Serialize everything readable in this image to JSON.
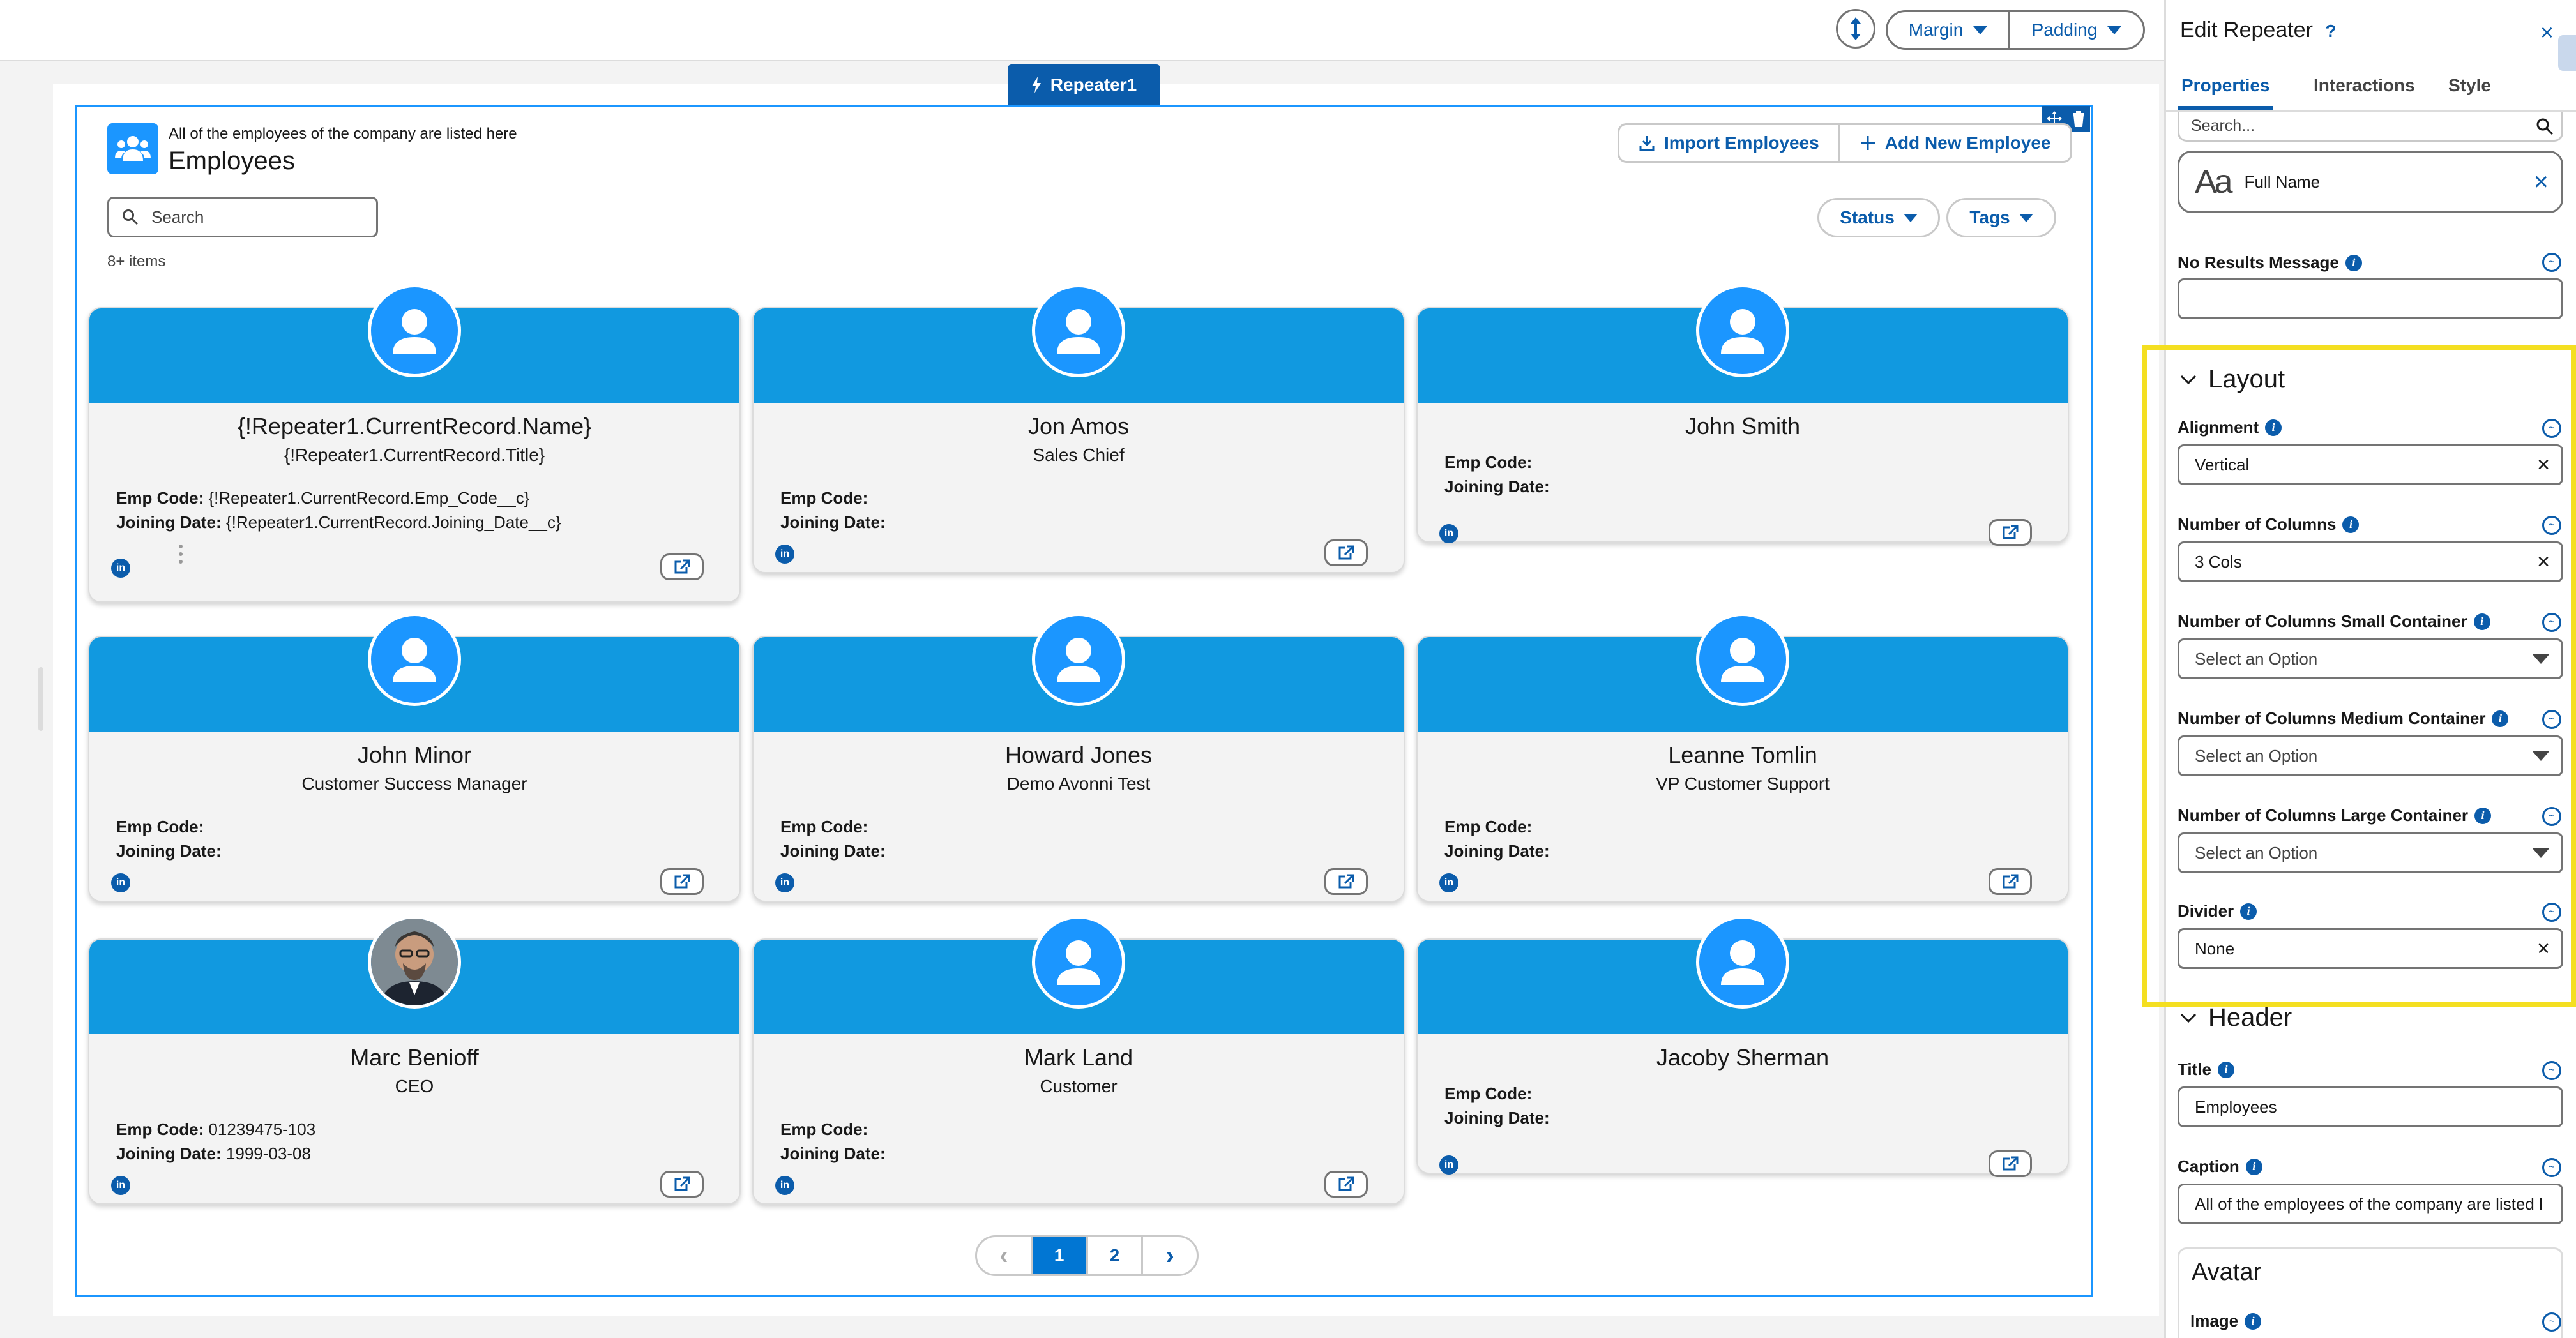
{
  "toolbar": {
    "margin_label": "Margin",
    "padding_label": "Padding"
  },
  "repeater": {
    "tab_label": "Repeater1",
    "caption": "All of the employees of the company are listed here",
    "title": "Employees",
    "import_label": "Import Employees",
    "add_label": "Add New Employee",
    "search_placeholder": "Search",
    "status_label": "Status",
    "tags_label": "Tags",
    "item_count": "8+ items"
  },
  "field_labels": {
    "emp_code": "Emp Code",
    "joining_date": "Joining Date",
    "linkedin": "in"
  },
  "cards": [
    {
      "name": "{!Repeater1.CurrentRecord.Name}",
      "title": "{!Repeater1.CurrentRecord.Title}",
      "emp_code": "{!Repeater1.CurrentRecord.Emp_Code__c}",
      "joining_date": "{!Repeater1.CurrentRecord.Joining_Date__c}"
    },
    {
      "name": "Jon Amos",
      "title": "Sales Chief",
      "emp_code": "",
      "joining_date": ""
    },
    {
      "name": "John Smith",
      "title": "",
      "emp_code": "",
      "joining_date": ""
    },
    {
      "name": "John Minor",
      "title": "Customer Success Manager",
      "emp_code": "",
      "joining_date": ""
    },
    {
      "name": "Howard Jones",
      "title": "Demo Avonni Test",
      "emp_code": "",
      "joining_date": ""
    },
    {
      "name": "Leanne Tomlin",
      "title": "VP Customer Support",
      "emp_code": "",
      "joining_date": ""
    },
    {
      "name": "Marc Benioff",
      "title": "CEO",
      "emp_code": "01239475-103",
      "joining_date": "1999-03-08"
    },
    {
      "name": "Mark Land",
      "title": "Customer",
      "emp_code": "",
      "joining_date": ""
    },
    {
      "name": "Jacoby Sherman",
      "title": "",
      "emp_code": "",
      "joining_date": ""
    }
  ],
  "pagination": {
    "pages": [
      "1",
      "2"
    ],
    "current": "1",
    "prev": "‹",
    "next": "›"
  },
  "panel": {
    "title": "Edit Repeater",
    "help_glyph": "?",
    "close_glyph": "×",
    "tabs": [
      "Properties",
      "Interactions",
      "Style"
    ],
    "search_placeholder": "Search...",
    "full_name_field": "Full Name",
    "full_name_icon_glyph": "Aa",
    "no_results_label": "No Results Message",
    "no_results_value": "",
    "layout_section": "Layout",
    "alignment_label": "Alignment",
    "alignment_value": "Vertical",
    "columns_label": "Number of Columns",
    "columns_value": "3 Cols",
    "columns_small_label": "Number of Columns Small Container",
    "columns_medium_label": "Number of Columns Medium Container",
    "columns_large_label": "Number of Columns Large Container",
    "select_placeholder": "Select an Option",
    "divider_label": "Divider",
    "divider_value": "None",
    "header_section": "Header",
    "title_label": "Title",
    "title_value": "Employees",
    "caption_label": "Caption",
    "caption_value": "All of the employees of the company are listed l",
    "avatar_section": "Avatar",
    "image_label": "Image"
  },
  "colors": {
    "brand": "#0b5cab",
    "card_band": "#1199e0",
    "highlight": "#f4df21",
    "avatar": "#1b96ff"
  }
}
